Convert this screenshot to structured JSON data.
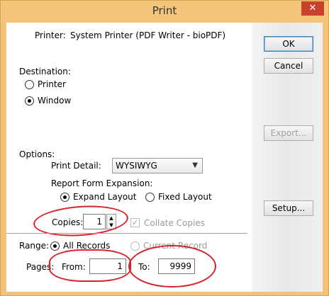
{
  "window": {
    "title": "Print",
    "close_symbol": "✕"
  },
  "printer": {
    "label": "Printer:",
    "value": "System Printer (PDF Writer - bioPDF)"
  },
  "buttons": {
    "ok": "OK",
    "cancel": "Cancel",
    "export": "Export...",
    "setup": "Setup..."
  },
  "destination": {
    "label": "Destination:",
    "options": [
      {
        "label": "Printer",
        "checked": false
      },
      {
        "label": "Window",
        "checked": true
      }
    ]
  },
  "options": {
    "label": "Options:",
    "print_detail_label": "Print Detail:",
    "print_detail_value": "WYSIWYG",
    "expansion_label": "Report Form Expansion:",
    "expansion_options": [
      {
        "label": "Expand Layout",
        "checked": true
      },
      {
        "label": "Fixed Layout",
        "checked": false
      }
    ],
    "copies_label": "Copies:",
    "copies_value": "1",
    "collate_label": "Collate Copies",
    "collate_checked": true
  },
  "range": {
    "label": "Range:",
    "options": [
      {
        "label": "All Records",
        "checked": true
      },
      {
        "label": "Current Record",
        "checked": false
      }
    ],
    "pages_label": "Pages:",
    "from_label": "From:",
    "from_value": "1",
    "to_label": "To:",
    "to_value": "9999"
  },
  "colors": {
    "annotation": "#d8222a",
    "titlebar": "#f3c47a",
    "close": "#c9402d"
  }
}
